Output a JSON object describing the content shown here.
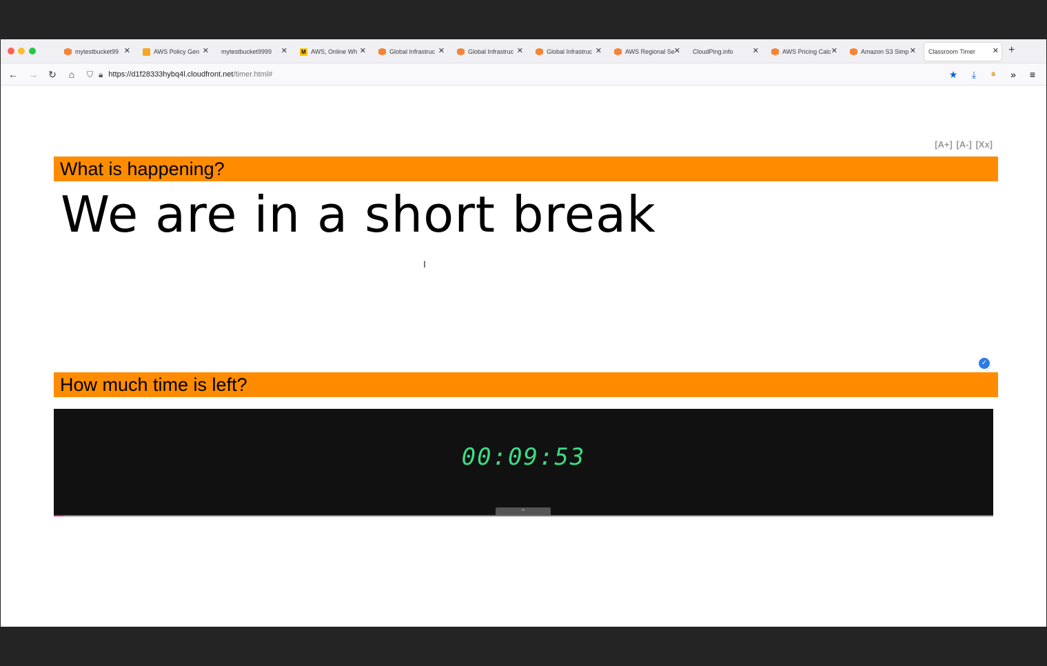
{
  "browser": {
    "tabs": [
      {
        "label": "mytestbucket99",
        "icon": "aws-cube-icon"
      },
      {
        "label": "AWS Policy Gen",
        "icon": "aws-policy-icon"
      },
      {
        "label": "mytestbucket9999",
        "icon": ""
      },
      {
        "label": "AWS, Online Wh",
        "icon": "miro-icon"
      },
      {
        "label": "Global Infrastruc",
        "icon": "aws-cube-icon"
      },
      {
        "label": "Global Infrastruc",
        "icon": "aws-cube-icon"
      },
      {
        "label": "Global Infrastruc",
        "icon": "aws-cube-icon"
      },
      {
        "label": "AWS Regional Se",
        "icon": "aws-cube-icon"
      },
      {
        "label": "CloudPing.info",
        "icon": ""
      },
      {
        "label": "AWS Pricing Calc",
        "icon": "aws-cube-icon"
      },
      {
        "label": "Amazon S3 Simp",
        "icon": "aws-cube-icon"
      },
      {
        "label": "Classroom Timer",
        "icon": "",
        "active": true
      }
    ],
    "close_glyph": "✕",
    "new_tab_glyph": "+",
    "url": {
      "host": "https://d1f28333hybq4l.cloudfront.net",
      "path": "/timer.html#"
    },
    "accent": "#0060df"
  },
  "page": {
    "font_controls": {
      "increase": "[A+]",
      "decrease": "[A-]",
      "reset": "[Xx]"
    },
    "what_heading": "What is happening?",
    "message": "We are in a short break",
    "how_heading": "How much time is left?",
    "timer": "00:09:53",
    "colors": {
      "section_bar": "#ff8c00",
      "timer_bg": "#111111",
      "timer_digits": "#3ddc84"
    }
  }
}
